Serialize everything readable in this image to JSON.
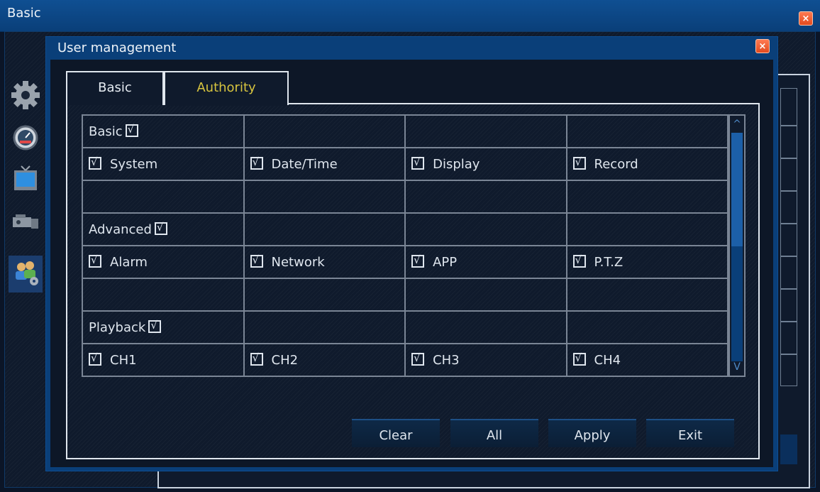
{
  "outer_window": {
    "title": "Basic",
    "close_label": "×"
  },
  "dialog": {
    "title": "User management",
    "close_label": "×"
  },
  "tabs": [
    {
      "label": "Basic",
      "active": false
    },
    {
      "label": "Authority",
      "active": true
    }
  ],
  "groups": {
    "basic": {
      "label": "Basic",
      "checked": true,
      "items": [
        "System",
        "Date/Time",
        "Display",
        "Record"
      ]
    },
    "advanced": {
      "label": "Advanced",
      "checked": true,
      "items": [
        "Alarm",
        "Network",
        "APP",
        "P.T.Z"
      ]
    },
    "playback": {
      "label": "Playback",
      "checked": true,
      "items": [
        "CH1",
        "CH2",
        "CH3",
        "CH4"
      ]
    }
  },
  "scrollbar": {
    "up": "^",
    "down": "V"
  },
  "buttons": {
    "clear": "Clear",
    "all": "All",
    "apply": "Apply",
    "exit": "Exit"
  },
  "colors": {
    "title_bar": "#0a3f79",
    "active_tab_text": "#d7c43f",
    "close_button": "#e24a1e"
  },
  "rail_icons": [
    "gear-icon",
    "gauge-icon",
    "monitor-icon",
    "camera-icon",
    "users-settings-icon"
  ]
}
